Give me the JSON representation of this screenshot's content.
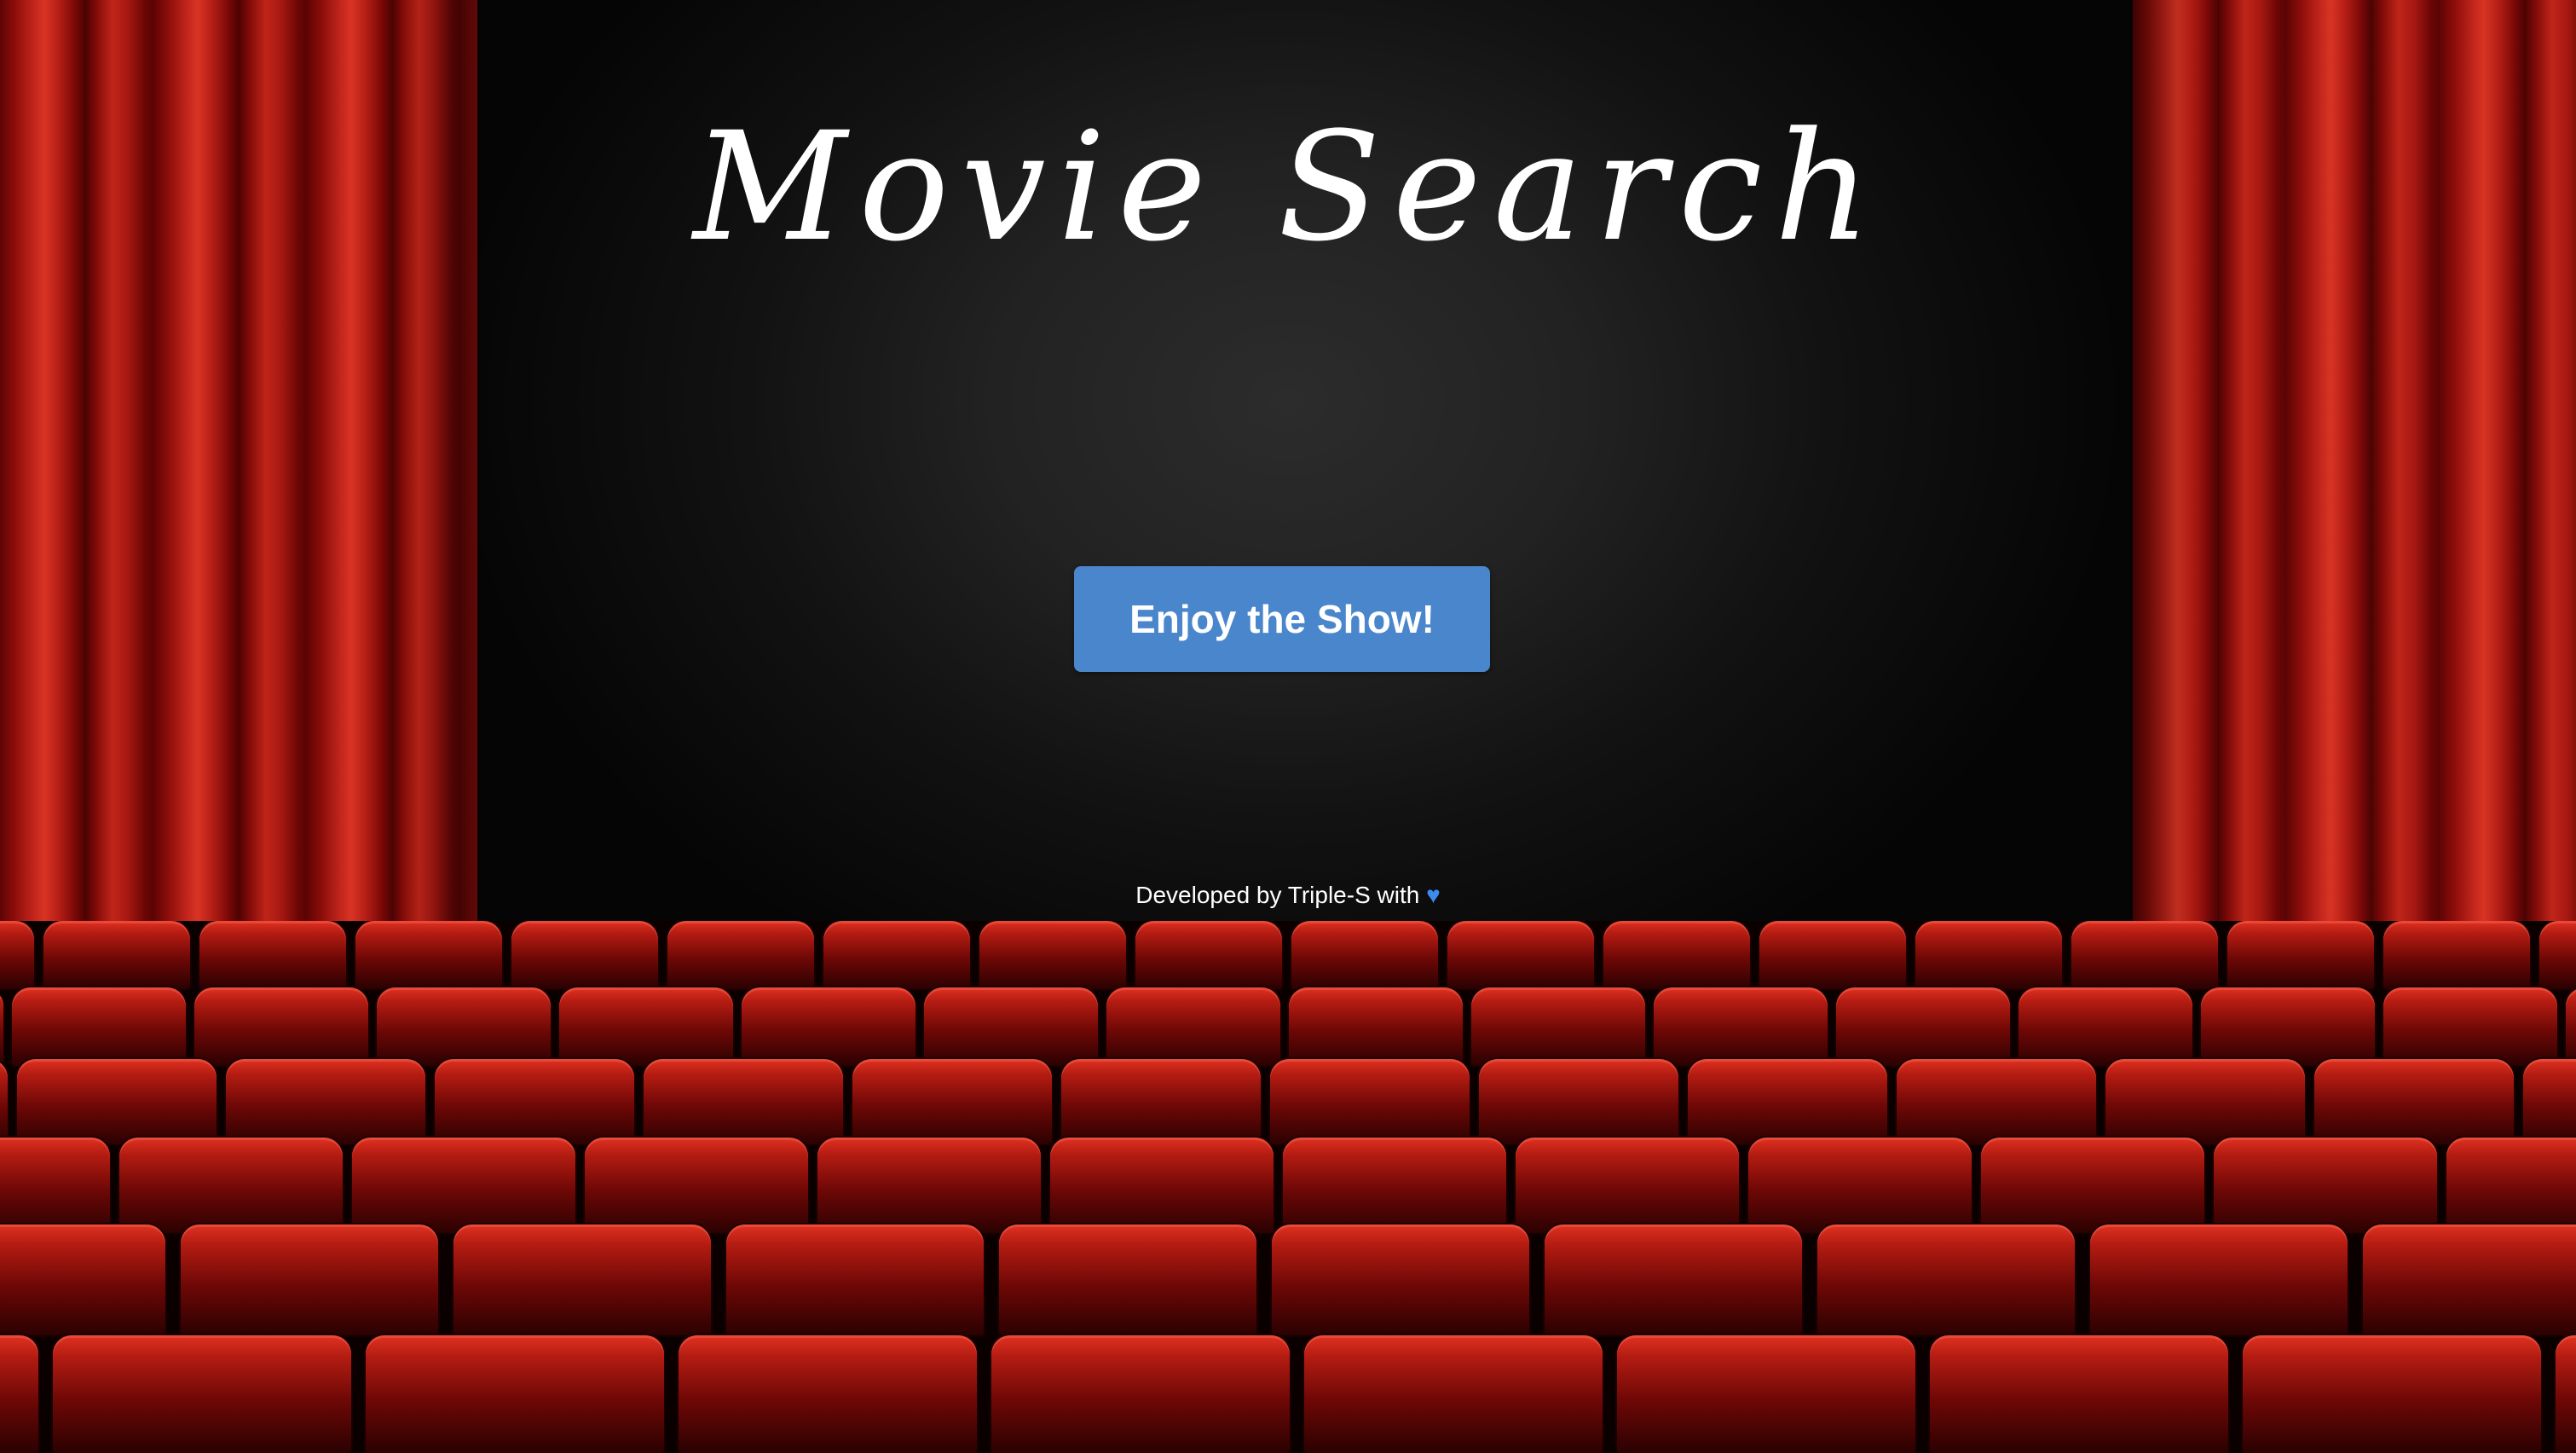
{
  "page": {
    "title": "Movie Search",
    "cta_label": "Enjoy the Show!",
    "footer_text": "Developed by Triple-S with",
    "footer_icon": "blue-heart-icon"
  },
  "colors": {
    "button_bg": "#4a86cc",
    "curtain_red": "#c3261c",
    "seat_red": "#e13222",
    "heart_blue": "#3d8bf0"
  }
}
